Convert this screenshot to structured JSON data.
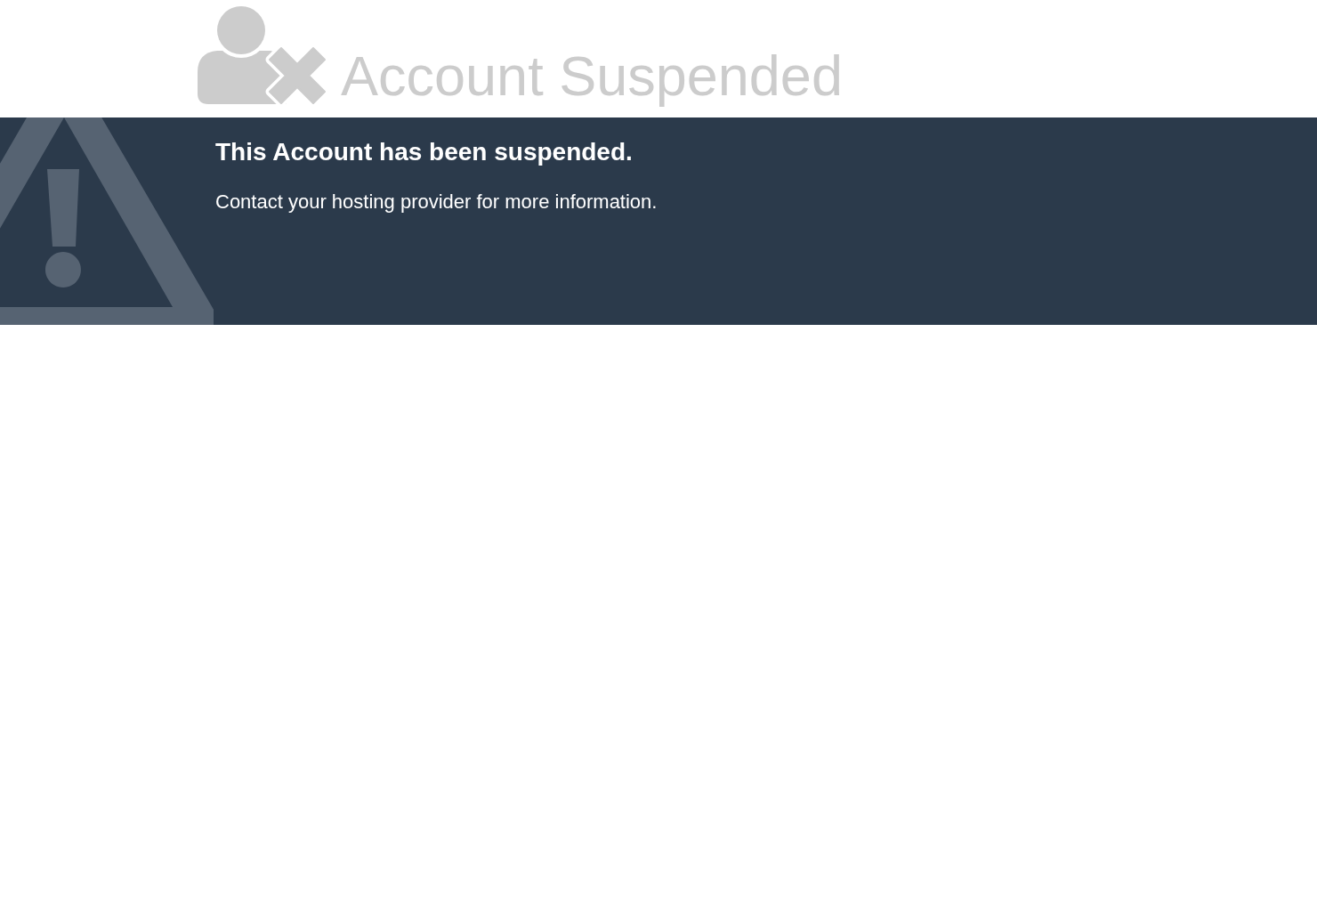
{
  "header": {
    "title": "Account Suspended"
  },
  "notice": {
    "heading": "This Account has been suspended.",
    "message": "Contact your hosting provider for more information."
  }
}
